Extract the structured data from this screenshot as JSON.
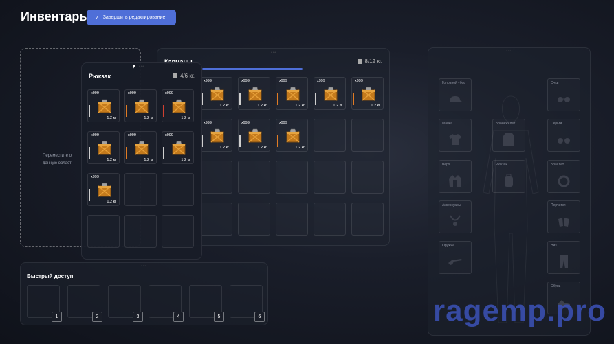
{
  "header": {
    "title": "Инвентарь",
    "finish_label": "Завершить редактирование"
  },
  "drop_zone": {
    "text": "Переместите о данную област"
  },
  "pockets": {
    "title": "Карманы",
    "weight": "8/12 кг.",
    "items": [
      {
        "qty": "x999",
        "kg": "1.2 кг",
        "bar": "#cfcfcf"
      },
      {
        "qty": "x999",
        "kg": "1.2 кг",
        "bar": "#cfcfcf"
      },
      {
        "qty": "x999",
        "kg": "1.2 кг",
        "bar": "#e07b24"
      },
      {
        "qty": "x999",
        "kg": "1.2 кг",
        "bar": "#cfcfcf"
      },
      {
        "qty": "x999",
        "kg": "1.2 кг",
        "bar": "#e07b24"
      },
      {
        "qty": "x999",
        "kg": "1.2 кг",
        "bar": "#cfcfcf"
      },
      {
        "qty": "x999",
        "kg": "1.2 кг",
        "bar": "#cfcfcf"
      },
      {
        "qty": "x999",
        "kg": "1.2 кг",
        "bar": "#e07b24"
      }
    ]
  },
  "backpack": {
    "title": "Рюкзак",
    "weight": "4/6 кг.",
    "items": [
      {
        "qty": "x999",
        "kg": "1.2 кг",
        "bar": "#cfcfcf"
      },
      {
        "qty": "x999",
        "kg": "1.2 кг",
        "bar": "#e07b24"
      },
      {
        "qty": "x999",
        "kg": "1.2 кг",
        "bar": "#d04030"
      },
      {
        "qty": "x999",
        "kg": "1.2 кг",
        "bar": "#cfcfcf"
      },
      {
        "qty": "x999",
        "kg": "1.2 кг",
        "bar": "#e07b24"
      },
      {
        "qty": "x999",
        "kg": "1.2 кг",
        "bar": "#cfcfcf"
      },
      {
        "qty": "x999",
        "kg": "1.2 кг",
        "bar": "#cfcfcf"
      }
    ]
  },
  "quick_access": {
    "title": "Быстрый доступ",
    "slots": [
      "1",
      "2",
      "3",
      "4",
      "5",
      "6"
    ]
  },
  "equipment": {
    "slots": {
      "hat": "Головной убор",
      "shirt": "Майка",
      "top": "Верх",
      "accessories": "Аксессуары",
      "weapon": "Оружие",
      "armor": "Бронежилет",
      "backpack": "Рюкзак",
      "glasses": "Очки",
      "earrings": "Серьги",
      "bracelet": "Браслет",
      "gloves": "Перчатки",
      "pants": "Низ",
      "shoes": "Обувь"
    }
  },
  "watermark": "ragemp.pro",
  "colors": {
    "accent": "#4f6fd8",
    "rarity_orange": "#e07b24",
    "rarity_red": "#d04030"
  }
}
